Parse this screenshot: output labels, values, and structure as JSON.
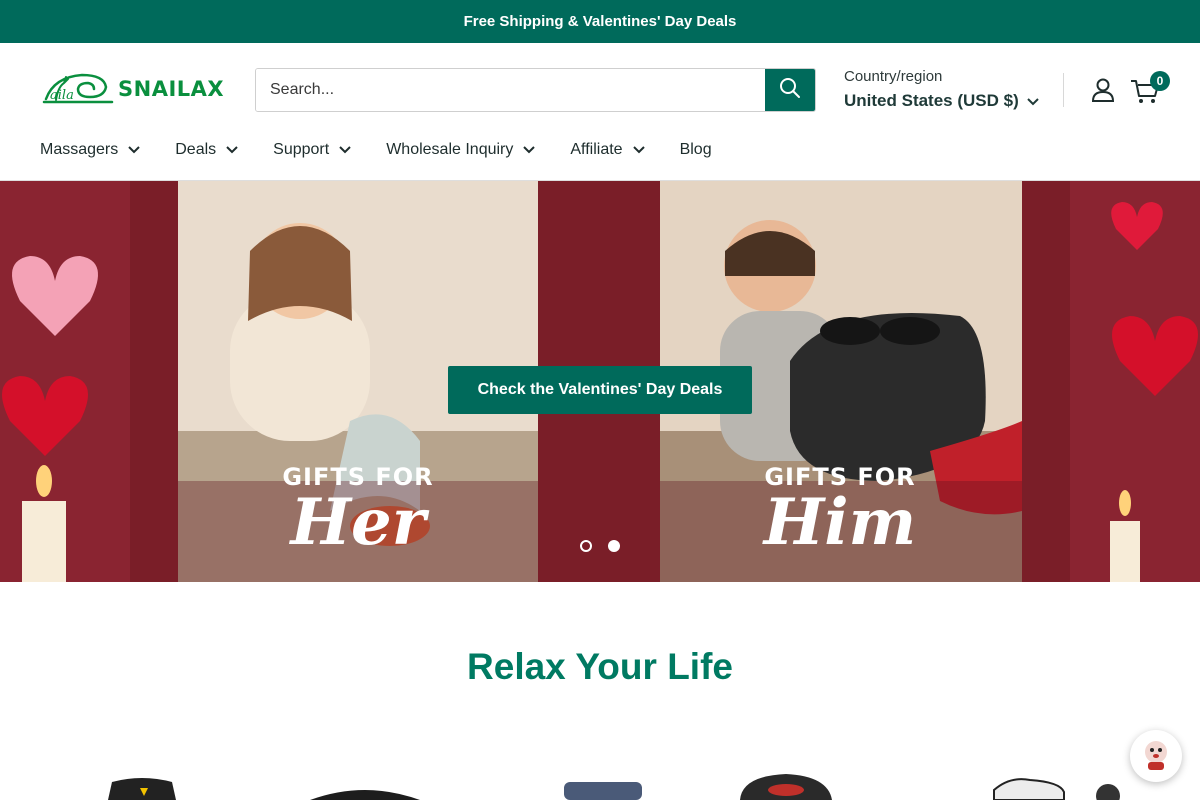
{
  "announcement": {
    "text": "Free Shipping & Valentines' Day Deals"
  },
  "header": {
    "logo_text": "SNAILAX",
    "search": {
      "placeholder": "Search...",
      "value": ""
    },
    "country": {
      "label": "Country/region",
      "value": "United States (USD $)"
    },
    "cart_count": "0"
  },
  "nav": {
    "items": [
      {
        "label": "Massagers"
      },
      {
        "label": "Deals"
      },
      {
        "label": "Support"
      },
      {
        "label": "Wholesale Inquiry"
      },
      {
        "label": "Affiliate"
      },
      {
        "label": "Blog"
      }
    ]
  },
  "hero": {
    "cta_label": "Check the Valentines' Day Deals",
    "left_banner": {
      "line1": "GIFTS FOR",
      "line2": "Her"
    },
    "right_banner": {
      "line1": "GIFTS FOR",
      "line2": "Him"
    },
    "slide_count": 2,
    "active_slide": 1
  },
  "section": {
    "title": "Relax Your Life"
  },
  "colors": {
    "brand": "#006a5b",
    "title": "#007a62",
    "logo": "#0a8f3e",
    "hero_bg": "#6b1a24"
  },
  "icons": [
    "search-icon",
    "chevron-down-icon",
    "account-icon",
    "cart-icon",
    "chat-icon",
    "snail-logo-icon"
  ]
}
